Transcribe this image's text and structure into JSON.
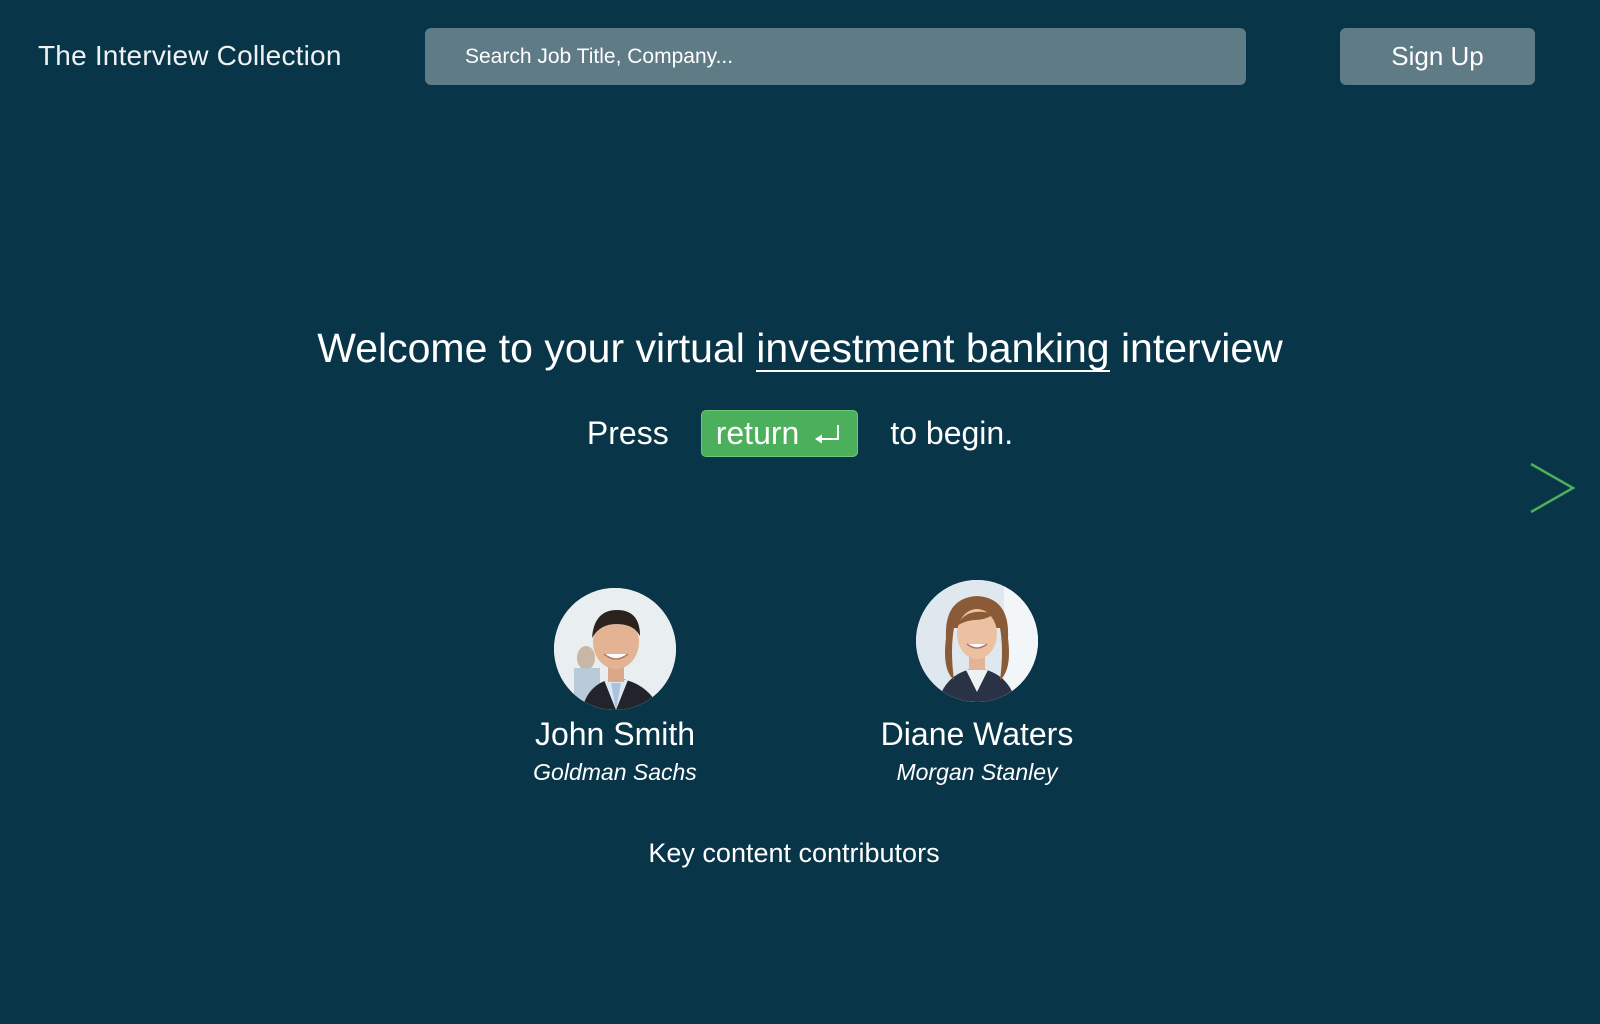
{
  "header": {
    "brand": "The Interview Collection",
    "search_placeholder": "Search Job Title, Company...",
    "signup_label": "Sign Up"
  },
  "hero": {
    "headline_prefix": "Welcome to your virtual",
    "headline_role": "investment banking",
    "headline_suffix": "interview",
    "press_label": "Press",
    "key_label": "return",
    "begin_label": "to begin."
  },
  "contributors": [
    {
      "name": "John Smith",
      "company": "Goldman Sachs"
    },
    {
      "name": "Diane Waters",
      "company": "Morgan Stanley"
    }
  ],
  "contributors_caption": "Key content contributors",
  "icons": {
    "return_key": "return-arrow-icon",
    "next": "chevron-right-icon"
  },
  "colors": {
    "background": "#093549",
    "control": "#5e7b86",
    "accent_green": "#4caf5c"
  }
}
